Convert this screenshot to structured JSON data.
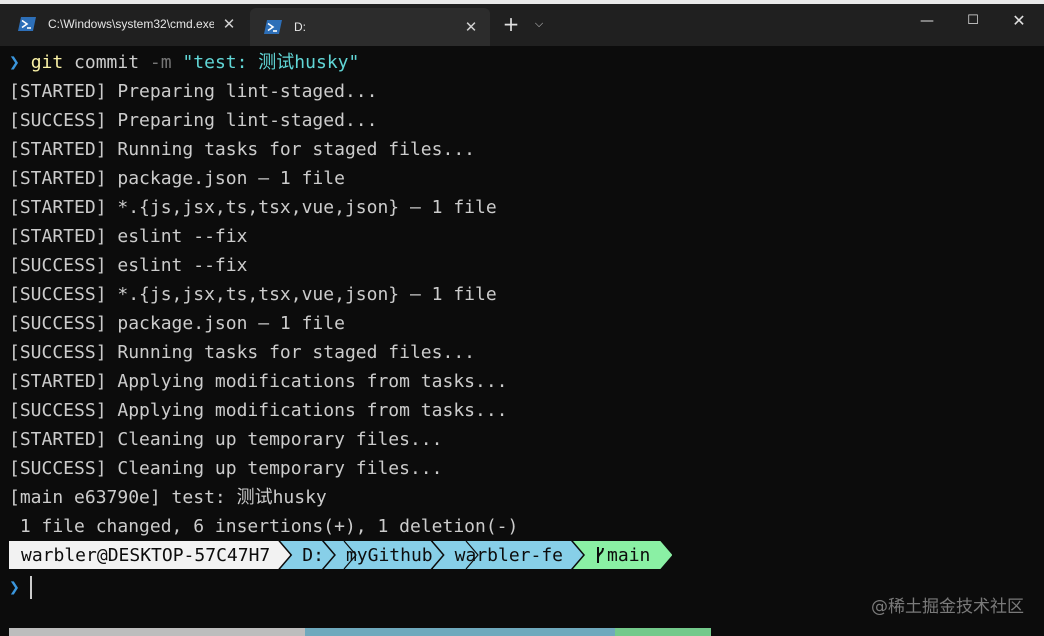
{
  "window": {
    "tabs": [
      {
        "title": "C:\\Windows\\system32\\cmd.exe",
        "active": false
      },
      {
        "title": "D:",
        "active": true
      }
    ],
    "tab_icon": "powershell-icon",
    "close_glyph": "✕",
    "new_tab_glyph": "+",
    "dropdown_glyph": "⌵",
    "minimize_glyph": "—",
    "maximize_glyph": "☐",
    "close_window_glyph": "✕"
  },
  "colors": {
    "background": "#0c0c0c",
    "titlebar": "#202020",
    "active_tab": "#2c2c2c",
    "foreground": "#cccccc",
    "prompt_chevron": "#3a96dd",
    "git_command": "#f9f1a5",
    "string": "#61d6d6",
    "segment_user": "#f2f2f2",
    "segment_path": "#87cfe8",
    "segment_branch": "#8af0a4"
  },
  "terminal": {
    "command": {
      "chevron": "❯",
      "program": "git",
      "subcommand": "commit",
      "flag": "-m",
      "message": "\"test: 测试husky\""
    },
    "output": [
      "[STARTED] Preparing lint-staged...",
      "[SUCCESS] Preparing lint-staged...",
      "[STARTED] Running tasks for staged files...",
      "[STARTED] package.json — 1 file",
      "[STARTED] *.{js,jsx,ts,tsx,vue,json} — 1 file",
      "[STARTED] eslint --fix",
      "[SUCCESS] eslint --fix",
      "[SUCCESS] *.{js,jsx,ts,tsx,vue,json} — 1 file",
      "[SUCCESS] package.json — 1 file",
      "[SUCCESS] Running tasks for staged files...",
      "[STARTED] Applying modifications from tasks...",
      "[SUCCESS] Applying modifications from tasks...",
      "[STARTED] Cleaning up temporary files...",
      "[SUCCESS] Cleaning up temporary files...",
      "[main e63790e] test: 测试husky",
      " 1 file changed, 6 insertions(+), 1 deletion(-)"
    ],
    "prompt": {
      "user_host": "warbler@DESKTOP-57C47H7",
      "drive": "D:",
      "dir1": "myGithub",
      "dir2": "warbler-fe",
      "branch_icon": "git-branch-icon",
      "branch": "main"
    },
    "input_chevron": "❯"
  },
  "watermark": "@稀土掘金技术社区"
}
